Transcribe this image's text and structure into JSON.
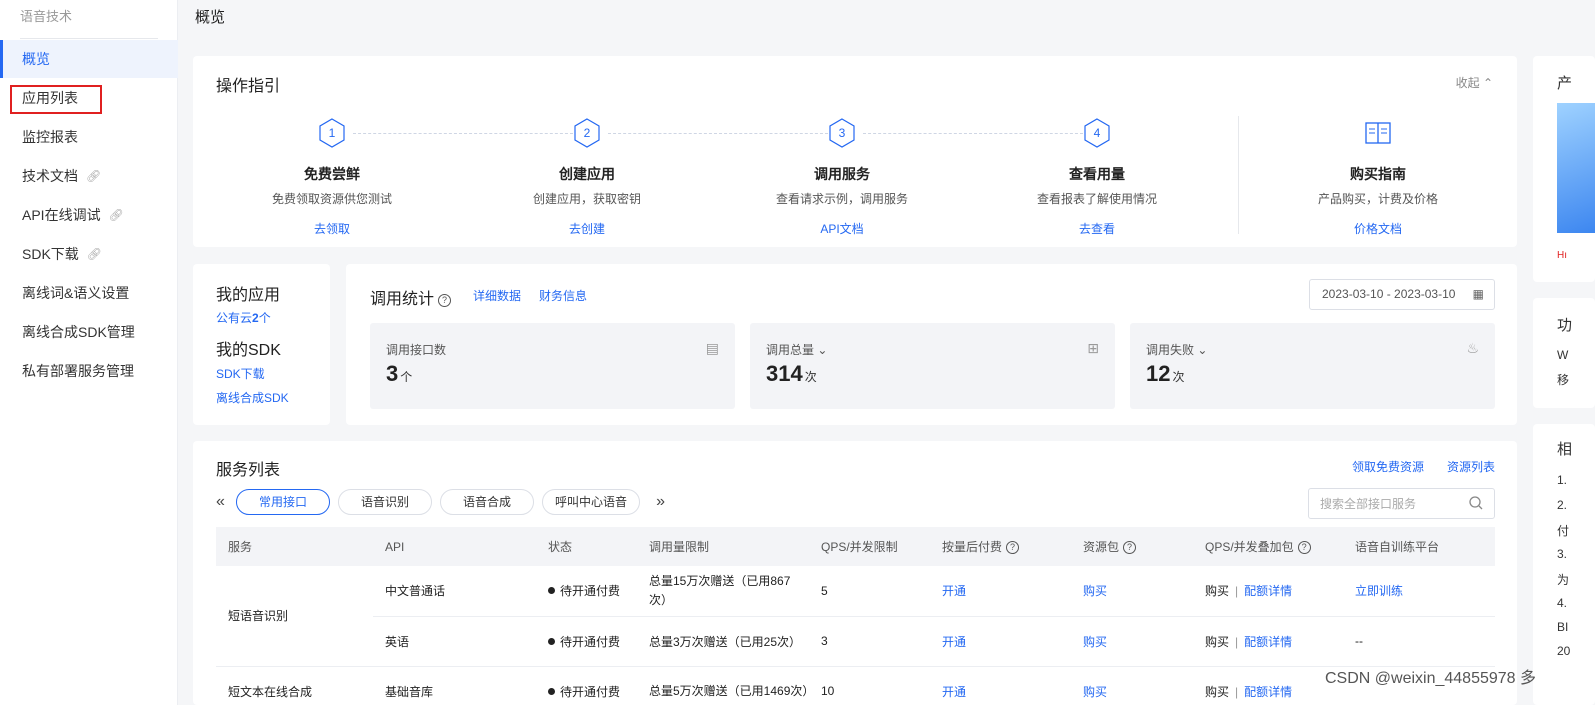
{
  "sidebar": {
    "title": "语音技术",
    "items": [
      {
        "label": "概览",
        "active": true,
        "link_icon": false
      },
      {
        "label": "应用列表",
        "active": false,
        "link_icon": false
      },
      {
        "label": "监控报表",
        "active": false,
        "link_icon": false
      },
      {
        "label": "技术文档",
        "active": false,
        "link_icon": true
      },
      {
        "label": "API在线调试",
        "active": false,
        "link_icon": true
      },
      {
        "label": "SDK下载",
        "active": false,
        "link_icon": true
      },
      {
        "label": "离线词&语义设置",
        "active": false,
        "link_icon": false
      },
      {
        "label": "离线合成SDK管理",
        "active": false,
        "link_icon": false
      },
      {
        "label": "私有部署服务管理",
        "active": false,
        "link_icon": false
      }
    ]
  },
  "header": {
    "title": "概览"
  },
  "guide": {
    "title": "操作指引",
    "collapse_label": "收起",
    "steps": [
      {
        "num": "1",
        "name": "免费尝鲜",
        "desc": "免费领取资源供您测试",
        "link": "去领取"
      },
      {
        "num": "2",
        "name": "创建应用",
        "desc": "创建应用，获取密钥",
        "link": "去创建"
      },
      {
        "num": "3",
        "name": "调用服务",
        "desc": "查看请求示例，调用服务",
        "link": "API文档"
      },
      {
        "num": "4",
        "name": "查看用量",
        "desc": "查看报表了解使用情况",
        "link": "去查看"
      }
    ],
    "buy": {
      "name": "购买指南",
      "desc": "产品购买，计费及价格",
      "link": "价格文档"
    }
  },
  "my_apps": {
    "apps_title": "我的应用",
    "apps_link_prefix": "公有云",
    "apps_count": "2",
    "apps_link_suffix": "个",
    "sdk_title": "我的SDK",
    "sdk_download": "SDK下载",
    "offline_sdk": "离线合成SDK"
  },
  "stats": {
    "title": "调用统计",
    "detail_link": "详细数据",
    "finance_link": "财务信息",
    "date_range": "2023-03-10 - 2023-03-10",
    "boxes": [
      {
        "label": "调用接口数",
        "value": "3",
        "unit": "个",
        "dropdown": false,
        "icon": "table-icon"
      },
      {
        "label": "调用总量",
        "value": "314",
        "unit": "次",
        "dropdown": true,
        "icon": "grid-icon"
      },
      {
        "label": "调用失败",
        "value": "12",
        "unit": "次",
        "dropdown": true,
        "icon": "fail-icon"
      }
    ]
  },
  "services": {
    "title": "服务列表",
    "free_link": "领取免费资源",
    "resource_link": "资源列表",
    "tabs": [
      {
        "label": "常用接口",
        "active": true
      },
      {
        "label": "语音识别",
        "active": false
      },
      {
        "label": "语音合成",
        "active": false
      },
      {
        "label": "呼叫中心语音",
        "active": false
      }
    ],
    "search_placeholder": "搜索全部接口服务",
    "columns": [
      "服务",
      "API",
      "状态",
      "调用量限制",
      "QPS/并发限制",
      "按量后付费",
      "资源包",
      "QPS/并发叠加包",
      "语音自训练平台"
    ],
    "rows": [
      {
        "service": "短语音识别",
        "api": "中文普通话",
        "status": "待开通付费",
        "limit": "总量15万次赠送（已用867次）",
        "qps": "5",
        "pay": "开通",
        "pack": "购买",
        "qps_buy": "购买",
        "qps_detail": "配额详情",
        "train": "立即训练"
      },
      {
        "service": "",
        "api": "英语",
        "status": "待开通付费",
        "limit": "总量3万次赠送（已用25次）",
        "qps": "3",
        "pay": "开通",
        "pack": "购买",
        "qps_buy": "购买",
        "qps_detail": "配额详情",
        "train": "--"
      },
      {
        "service": "短文本在线合成",
        "api": "基础音库",
        "status": "待开通付费",
        "limit": "总量5万次赠送（已用1469次）",
        "qps": "10",
        "pay": "开通",
        "pack": "购买",
        "qps_buy": "购买",
        "qps_detail": "配额详情",
        "train": ""
      }
    ]
  },
  "right_column": {
    "card1_title": "产",
    "card1_text": "Hı",
    "card2_title": "功",
    "card2_lines": [
      "W",
      "移"
    ],
    "card3_title": "相",
    "card3_lines": [
      "1.",
      "2.",
      "付",
      "3.",
      "为",
      "4.",
      "BI",
      "20"
    ]
  },
  "watermark": "CSDN @weixin_44855978 多"
}
